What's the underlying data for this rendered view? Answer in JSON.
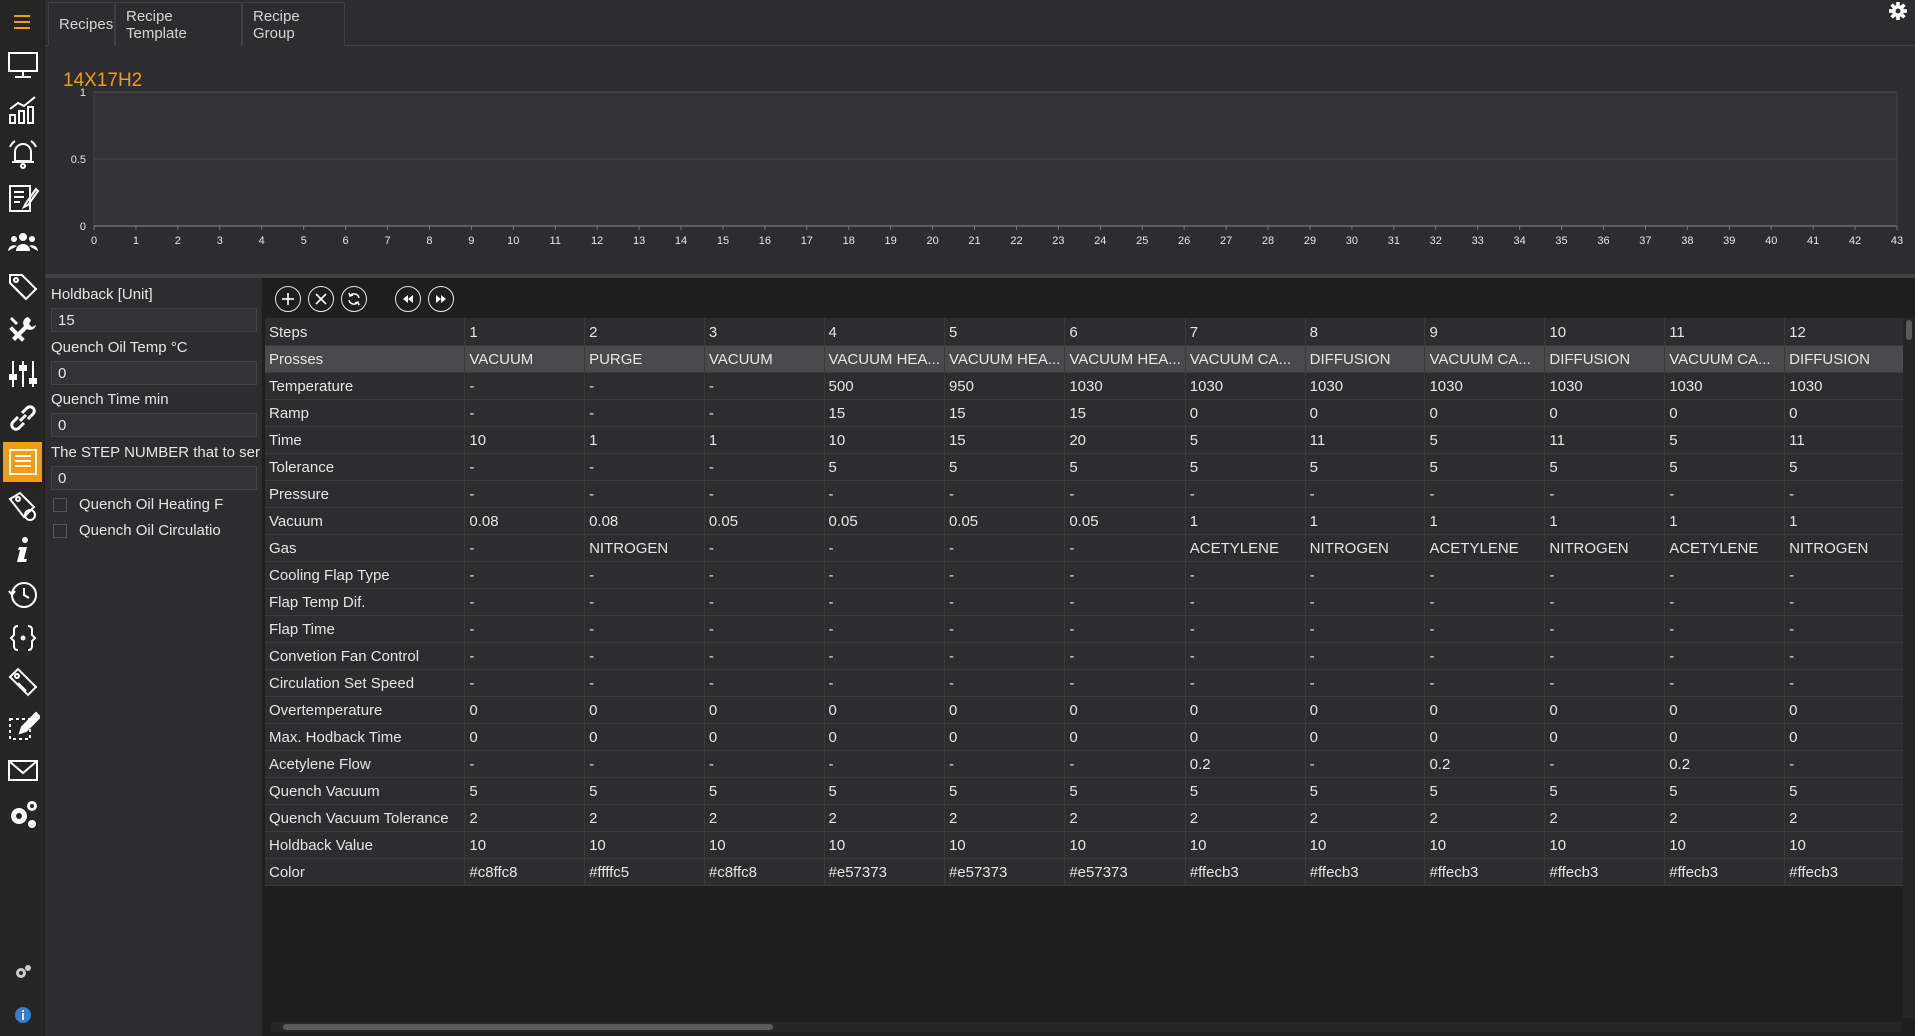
{
  "tabs": [
    {
      "label": "Recipes"
    },
    {
      "label": "Recipe Template"
    },
    {
      "label": "Recipe Group"
    }
  ],
  "accent_color": "#f39c12",
  "chart_data": {
    "type": "line",
    "title": "14X17H2",
    "x_ticks": [
      "0",
      "1",
      "2",
      "3",
      "4",
      "5",
      "6",
      "7",
      "8",
      "9",
      "10",
      "11",
      "12",
      "13",
      "14",
      "15",
      "16",
      "17",
      "18",
      "19",
      "20",
      "21",
      "22",
      "23",
      "24",
      "25",
      "26",
      "27",
      "28",
      "29",
      "30",
      "31",
      "32",
      "33",
      "34",
      "35",
      "36",
      "37",
      "38",
      "39",
      "40",
      "41",
      "42",
      "43"
    ],
    "y_ticks": [
      "0",
      "0.5",
      "1"
    ],
    "xlim": [
      0,
      43
    ],
    "ylim": [
      0,
      1
    ],
    "grid": true,
    "series": []
  },
  "params": {
    "holdback_label": "Holdback [Unit]",
    "holdback_value": "15",
    "quench_oil_temp_label": "Quench Oil Temp °C",
    "quench_oil_temp_value": "0",
    "quench_time_label": "Quench Time min",
    "quench_time_value": "0",
    "step_number_label": "The STEP NUMBER that to ser",
    "step_number_value": "0",
    "quench_oil_heating_label": "Quench Oil Heating F",
    "quench_oil_circulation_label": "Quench Oil Circulatio"
  },
  "icons": {
    "sidebar": [
      "monitor-icon",
      "trend-chart-icon",
      "alarm-bell-icon",
      "report-edit-icon",
      "users-group-icon",
      "tags-icon",
      "tools-icon",
      "sliders-icon",
      "link-icon",
      "recipe-list-icon",
      "tag-settings-icon",
      "info-icon",
      "history-icon",
      "code-braces-icon",
      "label-edit-icon",
      "edit-select-icon",
      "mail-icon",
      "settings-gears-icon",
      "small-gear-icon",
      "info-circle-icon"
    ],
    "toolbar": [
      "add-icon",
      "delete-icon",
      "refresh-icon",
      "rewind-icon",
      "fast-forward-icon"
    ]
  },
  "table": {
    "header_label": "Steps",
    "steps": [
      "1",
      "2",
      "3",
      "4",
      "5",
      "6",
      "7",
      "8",
      "9",
      "10",
      "11",
      "12"
    ],
    "rows": [
      {
        "label": "Prosses",
        "values": [
          "VACUUM",
          "PURGE",
          "VACUUM",
          "VACUUM HEA...",
          "VACUUM HEA...",
          "VACUUM HEA...",
          "VACUUM CA...",
          "DIFFUSION",
          "VACUUM CA...",
          "DIFFUSION",
          "VACUUM CA...",
          "DIFFUSION"
        ]
      },
      {
        "label": "Temperature",
        "values": [
          "-",
          "-",
          "-",
          "500",
          "950",
          "1030",
          "1030",
          "1030",
          "1030",
          "1030",
          "1030",
          "1030"
        ]
      },
      {
        "label": "Ramp",
        "values": [
          "-",
          "-",
          "-",
          "15",
          "15",
          "15",
          "0",
          "0",
          "0",
          "0",
          "0",
          "0"
        ]
      },
      {
        "label": "Time",
        "values": [
          "10",
          "1",
          "1",
          "10",
          "15",
          "20",
          "5",
          "11",
          "5",
          "11",
          "5",
          "11"
        ]
      },
      {
        "label": "Tolerance",
        "values": [
          "-",
          "-",
          "-",
          "5",
          "5",
          "5",
          "5",
          "5",
          "5",
          "5",
          "5",
          "5"
        ]
      },
      {
        "label": "Pressure",
        "values": [
          "-",
          "-",
          "-",
          "-",
          "-",
          "-",
          "-",
          "-",
          "-",
          "-",
          "-",
          "-"
        ]
      },
      {
        "label": "Vacuum",
        "values": [
          "0.08",
          "0.08",
          "0.05",
          "0.05",
          "0.05",
          "0.05",
          "1",
          "1",
          "1",
          "1",
          "1",
          "1"
        ]
      },
      {
        "label": "Gas",
        "values": [
          "-",
          "NITROGEN",
          "-",
          "-",
          "-",
          "-",
          "ACETYLENE",
          "NITROGEN",
          "ACETYLENE",
          "NITROGEN",
          "ACETYLENE",
          "NITROGEN"
        ]
      },
      {
        "label": "Cooling Flap Type",
        "values": [
          "-",
          "-",
          "-",
          "-",
          "-",
          "-",
          "-",
          "-",
          "-",
          "-",
          "-",
          "-"
        ]
      },
      {
        "label": "Flap Temp Dif.",
        "values": [
          "-",
          "-",
          "-",
          "-",
          "-",
          "-",
          "-",
          "-",
          "-",
          "-",
          "-",
          "-"
        ]
      },
      {
        "label": "Flap Time",
        "values": [
          "-",
          "-",
          "-",
          "-",
          "-",
          "-",
          "-",
          "-",
          "-",
          "-",
          "-",
          "-"
        ]
      },
      {
        "label": "Convetion Fan Control",
        "values": [
          "-",
          "-",
          "-",
          "-",
          "-",
          "-",
          "-",
          "-",
          "-",
          "-",
          "-",
          "-"
        ]
      },
      {
        "label": "Circulation Set Speed",
        "values": [
          "-",
          "-",
          "-",
          "-",
          "-",
          "-",
          "-",
          "-",
          "-",
          "-",
          "-",
          "-"
        ]
      },
      {
        "label": "Overtemperature",
        "values": [
          "0",
          "0",
          "0",
          "0",
          "0",
          "0",
          "0",
          "0",
          "0",
          "0",
          "0",
          "0"
        ]
      },
      {
        "label": "Max. Hodback Time",
        "values": [
          "0",
          "0",
          "0",
          "0",
          "0",
          "0",
          "0",
          "0",
          "0",
          "0",
          "0",
          "0"
        ]
      },
      {
        "label": "Acetylene Flow",
        "values": [
          "-",
          "-",
          "-",
          "-",
          "-",
          "-",
          "0.2",
          "-",
          "0.2",
          "-",
          "0.2",
          "-"
        ]
      },
      {
        "label": "Quench Vacuum",
        "values": [
          "5",
          "5",
          "5",
          "5",
          "5",
          "5",
          "5",
          "5",
          "5",
          "5",
          "5",
          "5"
        ]
      },
      {
        "label": "Quench Vacuum Tolerance",
        "values": [
          "2",
          "2",
          "2",
          "2",
          "2",
          "2",
          "2",
          "2",
          "2",
          "2",
          "2",
          "2"
        ]
      },
      {
        "label": "Holdback Value",
        "values": [
          "10",
          "10",
          "10",
          "10",
          "10",
          "10",
          "10",
          "10",
          "10",
          "10",
          "10",
          "10"
        ]
      },
      {
        "label": "Color",
        "values": [
          "#c8ffc8",
          "#ffffc5",
          "#c8ffc8",
          "#e57373",
          "#e57373",
          "#e57373",
          "#ffecb3",
          "#ffecb3",
          "#ffecb3",
          "#ffecb3",
          "#ffecb3",
          "#ffecb3"
        ]
      }
    ]
  }
}
